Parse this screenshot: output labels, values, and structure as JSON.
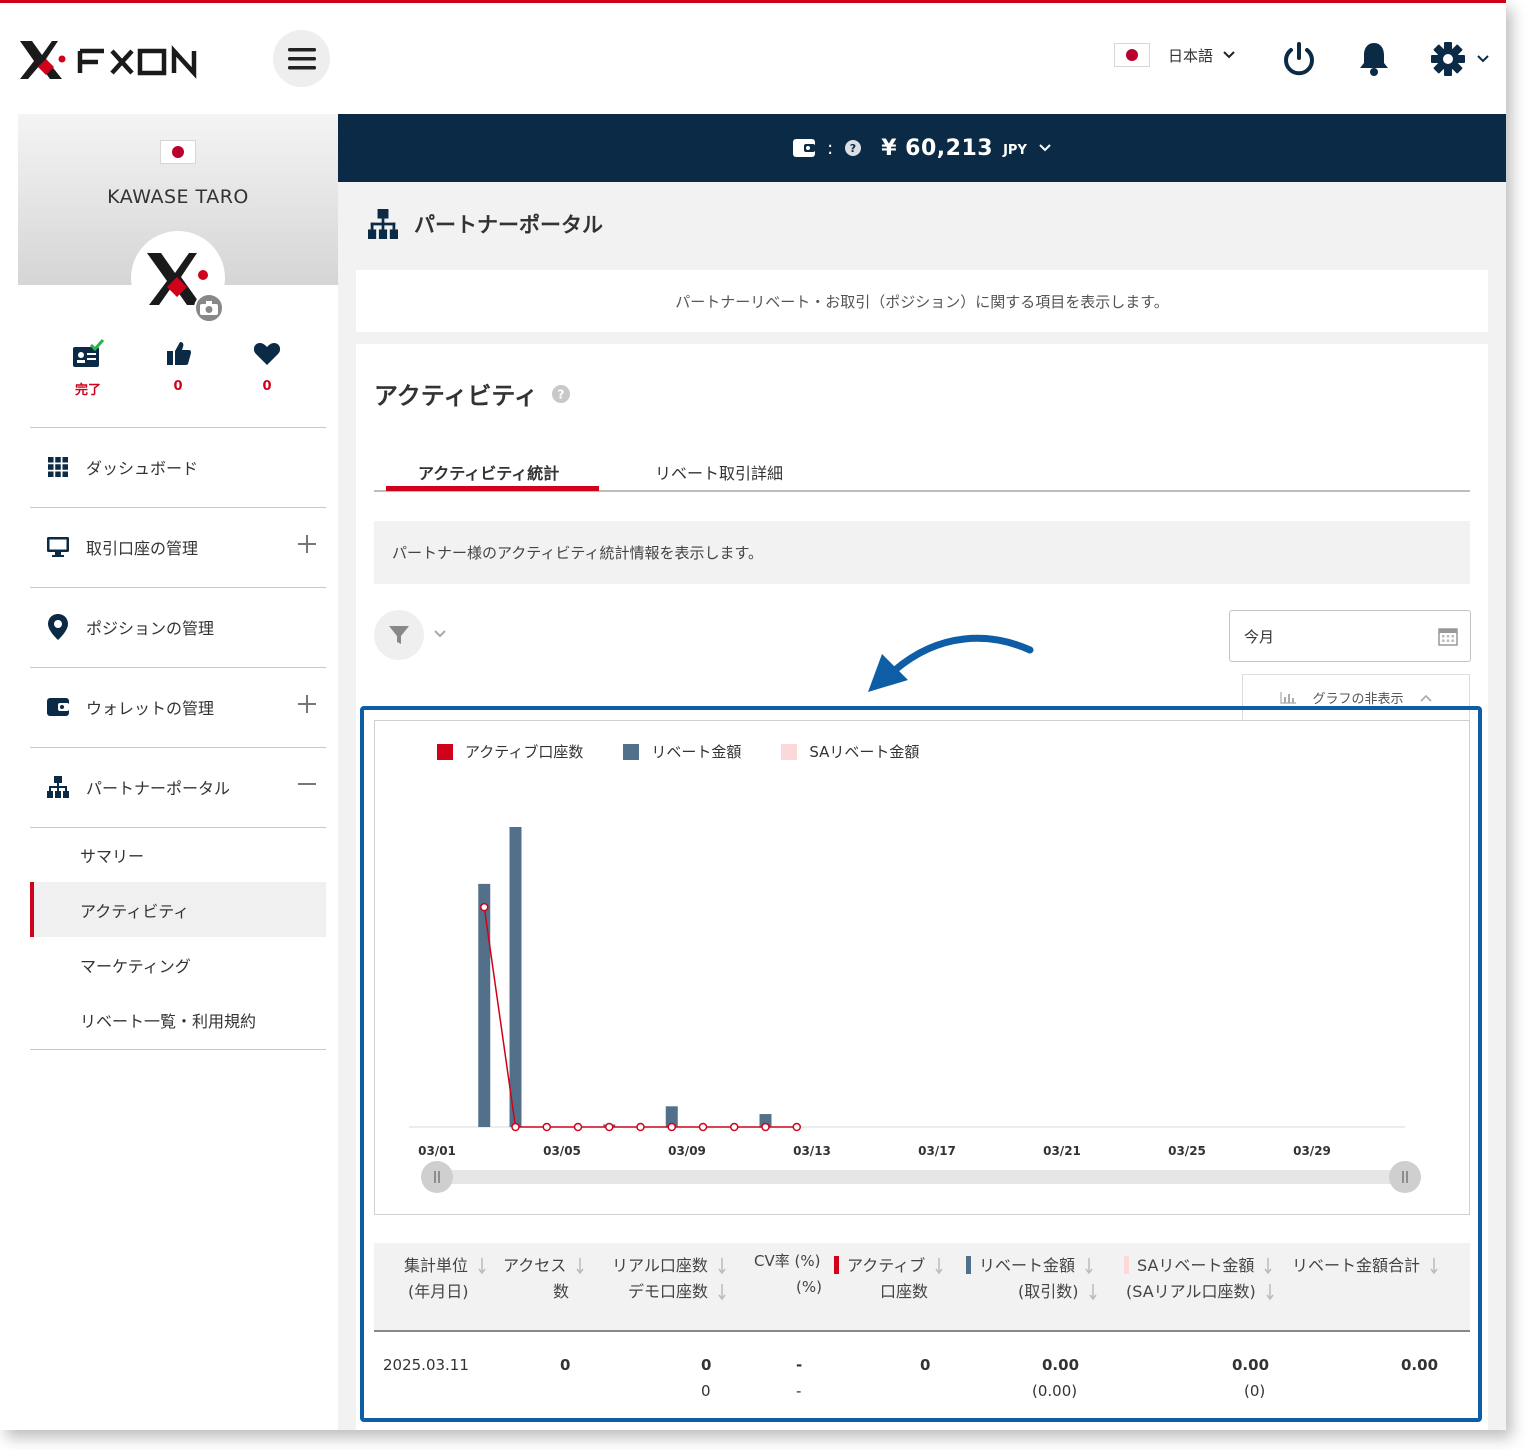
{
  "header": {
    "brand": "FXON",
    "language": "日本語",
    "icons": [
      "menu-icon",
      "power-icon",
      "bell-icon",
      "gear-icon"
    ]
  },
  "sidebar": {
    "user_name": "KAWASE TARO",
    "stats": [
      {
        "icon": "id-card-check-icon",
        "value": "完了"
      },
      {
        "icon": "thumbs-up-icon",
        "value": "0"
      },
      {
        "icon": "heart-icon",
        "value": "0"
      }
    ],
    "nav": [
      {
        "icon": "grid-icon",
        "label": "ダッシュボード",
        "toggle": ""
      },
      {
        "icon": "monitor-icon",
        "label": "取引口座の管理",
        "toggle": "plus"
      },
      {
        "icon": "map-pin-icon",
        "label": "ポジションの管理",
        "toggle": ""
      },
      {
        "icon": "wallet-icon",
        "label": "ウォレットの管理",
        "toggle": "plus"
      },
      {
        "icon": "org-chart-icon",
        "label": "パートナーポータル",
        "toggle": "minus"
      }
    ],
    "sub_nav": [
      "サマリー",
      "アクティビティ",
      "マーケティング",
      "リベート一覧・利用規約"
    ],
    "active_sub": "アクティビティ"
  },
  "balance": {
    "colon": ":",
    "amount": "¥ 60,213",
    "currency": "JPY"
  },
  "page": {
    "title": "パートナーポータル",
    "description": "パートナーリベート・お取引（ポジション）に関する項目を表示します。"
  },
  "activity": {
    "title": "アクティビティ",
    "tabs": [
      "アクティビティ統計",
      "リベート取引詳細"
    ],
    "info": "パートナー様のアクティビティ統計情報を表示します。",
    "date_value": "今月",
    "graph_toggle": "グラフの非表示"
  },
  "chart_data": {
    "type": "bar",
    "legend_placement": "top-left",
    "x_ticks": [
      "03/01",
      "03/05",
      "03/09",
      "03/13",
      "03/17",
      "03/21",
      "03/25",
      "03/29"
    ],
    "x": [
      "03/02",
      "03/03",
      "03/04",
      "03/05",
      "03/06",
      "03/07",
      "03/08",
      "03/09",
      "03/10",
      "03/11",
      "03/12"
    ],
    "series": [
      {
        "name": "アクティブ口座数",
        "type": "line",
        "color": "#d0021b",
        "values": [
          1.0,
          0,
          0,
          0,
          0,
          0,
          0,
          0,
          0,
          0,
          0
        ]
      },
      {
        "name": "リベート金額",
        "type": "bar",
        "color": "#527089",
        "values": [
          0.94,
          1.16,
          0,
          0,
          0.01,
          0,
          0.08,
          0,
          0,
          0.05,
          0
        ]
      },
      {
        "name": "SAリベート金額",
        "type": "bar",
        "color": "#fcd9d9",
        "values": [
          0,
          0,
          0,
          0,
          0,
          0,
          0,
          0,
          0,
          0,
          0
        ]
      }
    ],
    "grid": false
  },
  "table": {
    "headers": [
      {
        "line1": "集計単位",
        "line2": "(年月日)"
      },
      {
        "line1": "アクセス",
        "line2": "数"
      },
      {
        "line1": "リアル口座数",
        "line2": "デモ口座数"
      },
      {
        "line1": "CV率 (%)",
        "line2": "(%)"
      },
      {
        "line1": "アクティブ",
        "line2": "口座数"
      },
      {
        "line1": "リベート金額",
        "line2": "(取引数)"
      },
      {
        "line1": "SAリベート金額",
        "line2": "(SAリアル口座数)"
      },
      {
        "line1": "リベート金額合計",
        "line2": ""
      }
    ],
    "rows": [
      {
        "date": "2025.03.11",
        "access": "0",
        "real": "0",
        "demo": "0",
        "cv": "-",
        "cv2": "-",
        "active": "0",
        "rebate": "0.00",
        "rebate_count": "(0.00)",
        "sa_rebate": "0.00",
        "sa_count": "(0)",
        "total": "0.00"
      }
    ]
  }
}
